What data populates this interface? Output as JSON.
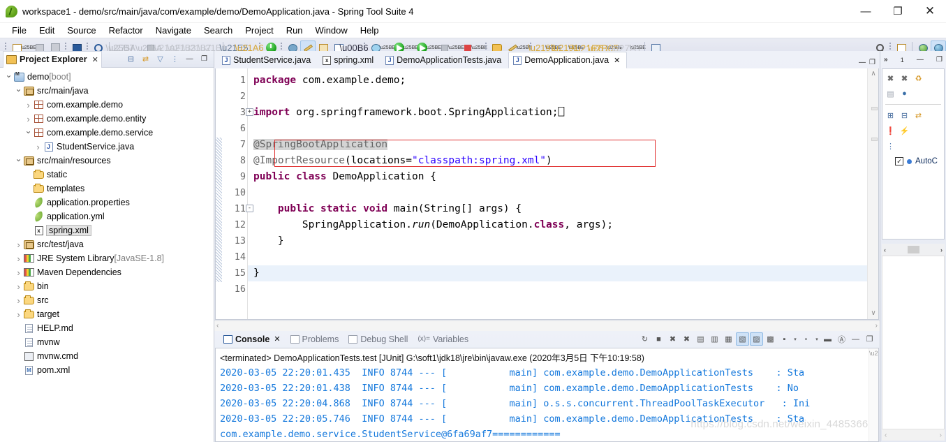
{
  "window": {
    "title": "workspace1 - demo/src/main/java/com/example/demo/DemoApplication.java - Spring Tool Suite 4",
    "minimize": "—",
    "maximize": "❐",
    "close": "✕"
  },
  "menu": {
    "items": [
      "File",
      "Edit",
      "Source",
      "Refactor",
      "Navigate",
      "Search",
      "Project",
      "Run",
      "Window",
      "Help"
    ]
  },
  "toolbar": {
    "groups": [
      {
        "items": [
          {
            "name": "new-wizard-icon",
            "glyph": "▣",
            "dropdown": true
          },
          {
            "name": "save-icon",
            "glyph": "▤"
          },
          {
            "name": "save-all-icon",
            "glyph": "❐"
          }
        ]
      },
      {
        "items": [
          {
            "name": "open-console-icon",
            "glyph": "■"
          }
        ]
      },
      {
        "items": [
          {
            "name": "skip-breakpoints-icon",
            "glyph": "●"
          }
        ]
      },
      {
        "items": [
          {
            "name": "resume-icon",
            "glyph": "▷"
          },
          {
            "name": "suspend-icon",
            "glyph": "❚❚"
          },
          {
            "name": "terminate-icon",
            "glyph": "■"
          },
          {
            "name": "disconnect-icon",
            "glyph": "↯"
          },
          {
            "name": "step-into-icon",
            "glyph": "↳"
          },
          {
            "name": "step-over-icon",
            "glyph": "↷"
          },
          {
            "name": "step-return-icon",
            "glyph": "↱"
          }
        ]
      },
      {
        "items": [
          {
            "name": "next-annotation-icon",
            "glyph": "⇥"
          },
          {
            "name": "previous-annotation-icon",
            "glyph": "↦"
          }
        ]
      },
      {
        "items": [
          {
            "name": "boot-restart-icon",
            "glyph": "⏻"
          }
        ]
      },
      {
        "items": [
          {
            "name": "debug-as-icon",
            "glyph": "⚙"
          }
        ]
      },
      {
        "items": [
          {
            "name": "spring-tools-icon",
            "glyph": "✎"
          },
          {
            "name": "open-task-icon",
            "glyph": "▥"
          },
          {
            "name": "open-type-icon",
            "glyph": "▦"
          },
          {
            "name": "show-whitespace-icon",
            "glyph": "¶"
          }
        ]
      },
      {
        "items": [
          {
            "name": "debug-icon",
            "glyph": "✸",
            "dropdown": true
          },
          {
            "name": "run-icon",
            "glyph": "▶",
            "dropdown": true
          },
          {
            "name": "run-as-server-icon",
            "glyph": "▶",
            "dropdown": true
          },
          {
            "name": "stop-icon",
            "glyph": "■",
            "dropdown": true
          },
          {
            "name": "relaunch-icon",
            "glyph": "▶",
            "dropdown": true
          }
        ]
      },
      {
        "items": [
          {
            "name": "new-java-package-icon",
            "glyph": "◑"
          },
          {
            "name": "new-java-class-icon",
            "glyph": "✎",
            "dropdown": true
          }
        ]
      },
      {
        "items": [
          {
            "name": "open-declaration-icon",
            "glyph": "↓",
            "dropdown": true
          },
          {
            "name": "open-call-hierarchy-icon",
            "glyph": "↑",
            "dropdown": true
          }
        ]
      },
      {
        "items": [
          {
            "name": "back-history-icon",
            "glyph": "⇦"
          },
          {
            "name": "previous-edit-icon",
            "glyph": "⬅",
            "dropdown": true
          },
          {
            "name": "forward-history-icon",
            "glyph": "➡",
            "dropdown": true
          }
        ]
      },
      {
        "items": [
          {
            "name": "pin-editor-icon",
            "glyph": "▧"
          }
        ]
      }
    ],
    "right": [
      {
        "name": "search-icon",
        "glyph": "⚲"
      },
      {
        "name": "open-perspective-icon",
        "glyph": "▨"
      },
      {
        "name": "perspective-spring-icon",
        "glyph": "☘"
      },
      {
        "name": "perspective-java-icon",
        "glyph": "✸"
      }
    ]
  },
  "explorer": {
    "title": "Project Explorer",
    "close_glyph": "✕",
    "tools": [
      {
        "name": "collapse-all-icon",
        "glyph": "⊟"
      },
      {
        "name": "link-with-editor-icon",
        "glyph": "⇄"
      },
      {
        "name": "view-filter-icon",
        "glyph": "▽"
      },
      {
        "name": "view-menu-icon",
        "glyph": "⋮"
      },
      {
        "name": "minimize-view-icon",
        "glyph": "—"
      },
      {
        "name": "maximize-view-icon",
        "glyph": "❐"
      }
    ],
    "tree": [
      {
        "label": "demo",
        "suffix": " [boot]",
        "indent": 0,
        "twisty": "open",
        "icon": "proj"
      },
      {
        "label": "src/main/java",
        "indent": 1,
        "twisty": "open",
        "icon": "pkgroot"
      },
      {
        "label": "com.example.demo",
        "indent": 2,
        "twisty": "closed",
        "icon": "pkg"
      },
      {
        "label": "com.example.demo.entity",
        "indent": 2,
        "twisty": "closed",
        "icon": "pkgw"
      },
      {
        "label": "com.example.demo.service",
        "indent": 2,
        "twisty": "open",
        "icon": "pkg"
      },
      {
        "label": "StudentService.java",
        "indent": 3,
        "twisty": "closed",
        "icon": "java"
      },
      {
        "label": "src/main/resources",
        "indent": 1,
        "twisty": "open",
        "icon": "pkgroot"
      },
      {
        "label": "static",
        "indent": 2,
        "twisty": "none",
        "icon": "folder"
      },
      {
        "label": "templates",
        "indent": 2,
        "twisty": "none",
        "icon": "folder"
      },
      {
        "label": "application.properties",
        "indent": 2,
        "twisty": "none",
        "icon": "leaf"
      },
      {
        "label": "application.yml",
        "indent": 2,
        "twisty": "none",
        "icon": "leaf"
      },
      {
        "label": "spring.xml",
        "indent": 2,
        "twisty": "none",
        "icon": "xml",
        "selected": true
      },
      {
        "label": "src/test/java",
        "indent": 1,
        "twisty": "closed",
        "icon": "pkgroot"
      },
      {
        "label": "JRE System Library",
        "suffix": " [JavaSE-1.8]",
        "indent": 1,
        "twisty": "closed",
        "icon": "lib"
      },
      {
        "label": "Maven Dependencies",
        "indent": 1,
        "twisty": "closed",
        "icon": "lib"
      },
      {
        "label": "bin",
        "indent": 1,
        "twisty": "closed",
        "icon": "folder"
      },
      {
        "label": "src",
        "indent": 1,
        "twisty": "closed",
        "icon": "folderw"
      },
      {
        "label": "target",
        "indent": 1,
        "twisty": "closed",
        "icon": "folder"
      },
      {
        "label": "HELP.md",
        "indent": 1,
        "twisty": "none",
        "icon": "doc"
      },
      {
        "label": "mvnw",
        "indent": 1,
        "twisty": "none",
        "icon": "doc"
      },
      {
        "label": "mvnw.cmd",
        "indent": 1,
        "twisty": "none",
        "icon": "cmd"
      },
      {
        "label": "pom.xml",
        "indent": 1,
        "twisty": "none",
        "icon": "pom"
      }
    ]
  },
  "editor": {
    "tabs": [
      {
        "label": "StudentService.java",
        "icon": "java",
        "active": false
      },
      {
        "label": "spring.xml",
        "icon": "xml",
        "active": false
      },
      {
        "label": "DemoApplicationTests.java",
        "icon": "java",
        "active": false
      },
      {
        "label": "DemoApplication.java",
        "icon": "java",
        "active": true,
        "close_glyph": "✕"
      }
    ],
    "tab_tools": [
      {
        "name": "minimize-editor-icon",
        "glyph": "—"
      },
      {
        "name": "maximize-editor-icon",
        "glyph": "❐"
      }
    ],
    "lines": [
      {
        "num": "1",
        "fold": "",
        "segments": [
          {
            "t": "package ",
            "c": "kw"
          },
          {
            "t": "com.example.demo;",
            "c": "plain"
          }
        ]
      },
      {
        "num": "2",
        "fold": "",
        "segments": []
      },
      {
        "num": "3",
        "fold": "+",
        "segments": [
          {
            "t": "import ",
            "c": "kw"
          },
          {
            "t": "org.springframework.boot.SpringApplication;",
            "c": "plain"
          },
          {
            "t": "⎕",
            "c": "box"
          }
        ]
      },
      {
        "num": "6",
        "fold": "",
        "segments": []
      },
      {
        "num": "7",
        "fold": "",
        "segments": [
          {
            "t": "@SpringBootApplication",
            "c": "anhl"
          }
        ]
      },
      {
        "num": "8",
        "fold": "",
        "segments": [
          {
            "t": "@ImportResource",
            "c": "an"
          },
          {
            "t": "(locations=",
            "c": "plain"
          },
          {
            "t": "\"classpath:spring.xml\"",
            "c": "str"
          },
          {
            "t": ")",
            "c": "plain"
          }
        ]
      },
      {
        "num": "9",
        "fold": "",
        "segments": [
          {
            "t": "public class ",
            "c": "kw"
          },
          {
            "t": "DemoApplication {",
            "c": "plain"
          }
        ]
      },
      {
        "num": "10",
        "fold": "",
        "segments": []
      },
      {
        "num": "11",
        "fold": "-",
        "segments": [
          {
            "t": "    ",
            "c": "plain"
          },
          {
            "t": "public static void ",
            "c": "kw"
          },
          {
            "t": "main(String[] args) {",
            "c": "plain"
          }
        ]
      },
      {
        "num": "12",
        "fold": "",
        "segments": [
          {
            "t": "        SpringApplication.",
            "c": "plain"
          },
          {
            "t": "run",
            "c": "it"
          },
          {
            "t": "(DemoApplication.",
            "c": "plain"
          },
          {
            "t": "class",
            "c": "kw"
          },
          {
            "t": ", args);",
            "c": "plain"
          }
        ]
      },
      {
        "num": "13",
        "fold": "",
        "segments": [
          {
            "t": "    }",
            "c": "plain"
          }
        ]
      },
      {
        "num": "14",
        "fold": "",
        "segments": []
      },
      {
        "num": "15",
        "fold": "",
        "segments": [
          {
            "t": "}",
            "c": "plain"
          }
        ],
        "highlight": true
      },
      {
        "num": "16",
        "fold": "",
        "segments": []
      }
    ],
    "scroll": {
      "up_glyph": "∧",
      "down_glyph": "∨",
      "h_right_glyph": "›",
      "h_left_glyph": "‹"
    }
  },
  "console": {
    "tabs": [
      {
        "label": "Console",
        "active": true,
        "close_glyph": "✕",
        "icon": "console-icon"
      },
      {
        "label": "Problems",
        "active": false,
        "icon": "problems-icon"
      },
      {
        "label": "Debug Shell",
        "active": false,
        "icon": "debug-shell-icon"
      },
      {
        "label": "Variables",
        "active": false,
        "icon": "variables-icon",
        "prefix": "(x)="
      }
    ],
    "tools": [
      {
        "name": "terminate-relaunch-icon",
        "glyph": "↻"
      },
      {
        "name": "terminate-icon",
        "glyph": "■"
      },
      {
        "name": "remove-launch-icon",
        "glyph": "✖"
      },
      {
        "name": "remove-all-terminated-icon",
        "glyph": "✖"
      },
      {
        "name": "clear-console-icon",
        "glyph": "▤"
      },
      {
        "name": "lock-scroll-icon",
        "glyph": "▥"
      },
      {
        "name": "show-console-on-output-icon",
        "glyph": "▦"
      },
      {
        "name": "show-stdout-icon",
        "glyph": "▧",
        "selected": true
      },
      {
        "name": "show-stderr-icon",
        "glyph": "▨",
        "selected": true
      },
      {
        "name": "pin-console-icon",
        "glyph": "▩"
      },
      {
        "name": "display-selected-console-icon",
        "glyph": "▪",
        "dropdown": true
      },
      {
        "name": "open-console-icon",
        "glyph": "▫",
        "dropdown": true
      },
      {
        "name": "word-wrap-icon",
        "glyph": "▬"
      },
      {
        "name": "ansi-console-icon",
        "glyph": "Ⓐ"
      },
      {
        "name": "minimize-console-icon",
        "glyph": "—"
      },
      {
        "name": "maximize-console-icon",
        "glyph": "❐"
      }
    ],
    "terminated_line": "<terminated> DemoApplicationTests.test [JUnit] G:\\soft1\\jdk18\\jre\\bin\\javaw.exe (2020年3月5日 下午10:19:58)",
    "log_lines": [
      "2020-03-05 22:20:01.435  INFO 8744 --- [           main] com.example.demo.DemoApplicationTests    : Sta",
      "2020-03-05 22:20:01.438  INFO 8744 --- [           main] com.example.demo.DemoApplicationTests    : No ",
      "2020-03-05 22:20:04.868  INFO 8744 --- [           main] o.s.s.concurrent.ThreadPoolTaskExecutor   : Ini",
      "2020-03-05 22:20:05.746  INFO 8744 --- [           main] com.example.demo.DemoApplicationTests    : Sta",
      "com.example.demo.service.StudentService@6fa69af7============"
    ],
    "watermark": "https://blog.csdn.net/weixin_44853669"
  },
  "right_panel": {
    "overflow_label": "»",
    "overflow_count": "1",
    "head_tools": [
      {
        "name": "minimize-panel-icon",
        "glyph": "—"
      },
      {
        "name": "maximize-panel-icon",
        "glyph": "❐"
      }
    ],
    "rows": [
      [
        {
          "name": "stop-boot-app-icon",
          "glyph": "✖"
        },
        {
          "name": "stop-all-boot-apps-icon",
          "glyph": "✖"
        },
        {
          "name": "redeploy-icon",
          "glyph": "♻"
        }
      ],
      [
        {
          "name": "open-config-icon",
          "glyph": "▤"
        },
        {
          "name": "disable-live-icon",
          "glyph": "●"
        }
      ],
      [
        {
          "name": "add-boot-project-icon",
          "glyph": "⊞"
        },
        {
          "name": "remove-boot-project-icon",
          "glyph": "⊟"
        },
        {
          "name": "link-boot-dash-icon",
          "glyph": "⇄"
        }
      ],
      [
        {
          "name": "java-error-icon",
          "glyph": "❗"
        },
        {
          "name": "quick-fix-icon",
          "glyph": "⚡"
        }
      ],
      [
        {
          "name": "view-menu-icon",
          "glyph": "⋮"
        }
      ]
    ],
    "autoconnect": {
      "checkbox_glyph": "✓",
      "label": "AutoC"
    },
    "mini": {
      "left_glyph": "‹",
      "right_glyph": "›",
      "prev_glyph": "‹",
      "next_glyph": "›"
    }
  },
  "colors": {
    "accent": "#1478dc",
    "keyword": "#7f0055",
    "string": "#2a00ff",
    "annotation": "#646464",
    "error_box": "#e03030",
    "selection": "#eaf2fb"
  }
}
